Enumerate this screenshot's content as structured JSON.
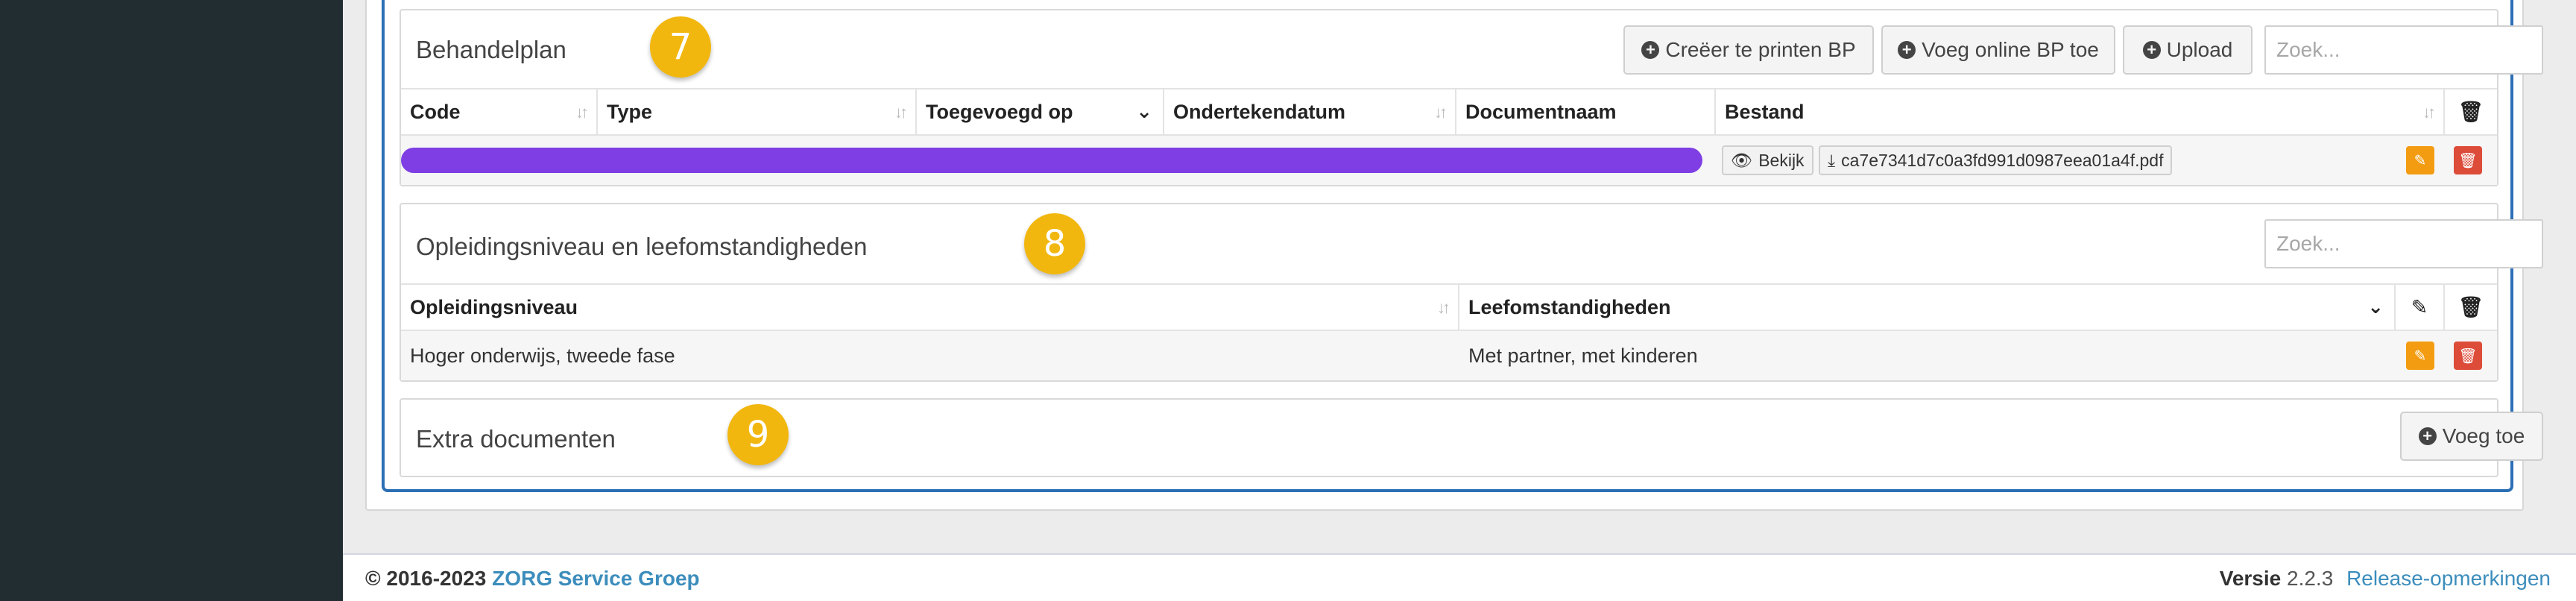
{
  "panels": {
    "behandelplan": {
      "title": "Behandelplan",
      "badge": "7",
      "buttons": {
        "create": "Creëer te printen BP",
        "add_online": "Voeg online BP toe",
        "upload": "Upload"
      },
      "search_placeholder": "Zoek...",
      "columns": [
        "Code",
        "Type",
        "Toegevoegd op",
        "Ondertekendatum",
        "Documentnaam",
        "Bestand"
      ],
      "row": {
        "view_label": "Bekijk",
        "file_name": "ca7e7341d7c0a3fd991d0987eea01a4f.pdf"
      }
    },
    "opleiding": {
      "title": "Opleidingsniveau en leefomstandigheden",
      "badge": "8",
      "search_placeholder": "Zoek...",
      "columns": [
        "Opleidingsniveau",
        "Leefomstandigheden"
      ],
      "row": {
        "opleidingsniveau": "Hoger onderwijs, tweede fase",
        "leefomstandigheden": "Met partner, met kinderen"
      }
    },
    "extra": {
      "title": "Extra documenten",
      "badge": "9",
      "add_label": "Voeg toe"
    }
  },
  "footer": {
    "copyright": "© 2016-2023",
    "company": "ZORG Service Groep",
    "version_label": "Versie",
    "version": "2.2.3",
    "release_notes": "Release-opmerkingen"
  },
  "colors": {
    "sidebar": "#222d32",
    "accent_blue": "#2c6fb5",
    "badge": "#f2b70f",
    "redaction": "#7e3ee4",
    "edit": "#f39c12",
    "delete": "#dd4b39"
  }
}
